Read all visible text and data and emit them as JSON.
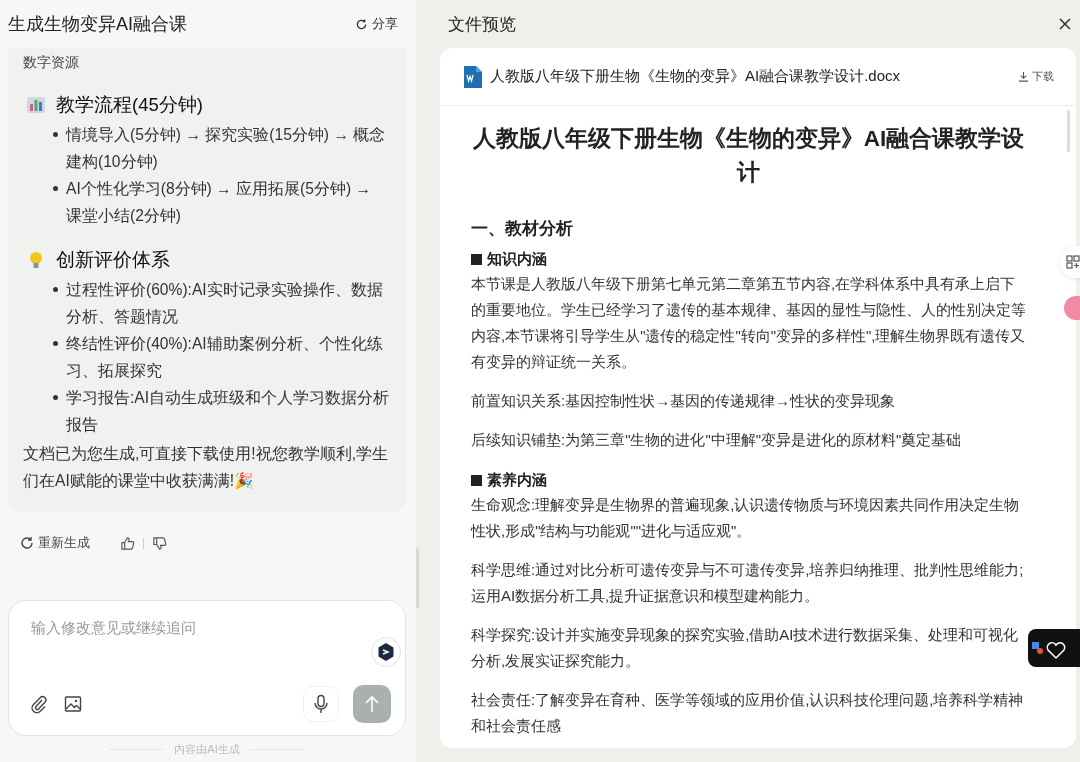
{
  "chat": {
    "title": "生成生物变异AI融合课",
    "share": "分享",
    "message": {
      "top_text": "数字资源",
      "sections": [
        {
          "heading": "教学流程(45分钟)",
          "items": [
            "情境导入(5分钟) → 探究实验(15分钟) → 概念建构(10分钟)",
            "AI个性化学习(8分钟) → 应用拓展(5分钟) → 课堂小结(2分钟)"
          ]
        },
        {
          "heading": "创新评价体系",
          "items": [
            "过程性评价(60%):AI实时记录实验操作、数据分析、答题情况",
            "终结性评价(40%):AI辅助案例分析、个性化练习、拓展探究",
            "学习报告:AI自动生成班级和个人学习数据分析报告"
          ]
        }
      ],
      "closing": "文档已为您生成,可直接下载使用!祝您教学顺利,学生们在AI赋能的课堂中收获满满!🎉"
    },
    "regenerate": "重新生成",
    "input": {
      "placeholder": "输入修改意见或继续追问"
    },
    "footer": "内容由AI生成"
  },
  "preview": {
    "title": "文件预览",
    "file": {
      "name": "人教版八年级下册生物《生物的变异》AI融合课教学设计.docx",
      "download": "下载"
    },
    "doc": {
      "title": "人教版八年级下册生物《生物的变异》AI融合课教学设计",
      "blocks": [
        {
          "kind": "h1",
          "text": "一、教材分析"
        },
        {
          "kind": "h2",
          "text": "知识内涵"
        },
        {
          "kind": "p",
          "text": "本节课是人教版八年级下册第七单元第二章第五节内容,在学科体系中具有承上启下的重要地位。学生已经学习了遗传的基本规律、基因的显性与隐性、人的性别决定等内容,本节课将引导学生从\"遗传的稳定性\"转向\"变异的多样性\",理解生物界既有遗传又有变异的辩证统一关系。"
        },
        {
          "kind": "p",
          "text": "前置知识关系:基因控制性状→基因的传递规律→性状的变异现象"
        },
        {
          "kind": "p2",
          "text": "后续知识铺垫:为第三章\"生物的进化\"中理解\"变异是进化的原材料\"奠定基础"
        },
        {
          "kind": "h2",
          "text": "素养内涵"
        },
        {
          "kind": "p",
          "text": "生命观念:理解变异是生物界的普遍现象,认识遗传物质与环境因素共同作用决定生物性状,形成\"结构与功能观\"\"进化与适应观\"。"
        },
        {
          "kind": "p",
          "text": "科学思维:通过对比分析可遗传变异与不可遗传变异,培养归纳推理、批判性思维能力;运用AI数据分析工具,提升证据意识和模型建构能力。"
        },
        {
          "kind": "p",
          "text": "科学探究:设计并实施变异现象的探究实验,借助AI技术进行数据采集、处理和可视化分析,发展实证探究能力。"
        },
        {
          "kind": "p",
          "text": "社会责任:了解变异在育种、医学等领域的应用价值,认识科技伦理问题,培养科学精神和社会责任感"
        }
      ]
    }
  }
}
